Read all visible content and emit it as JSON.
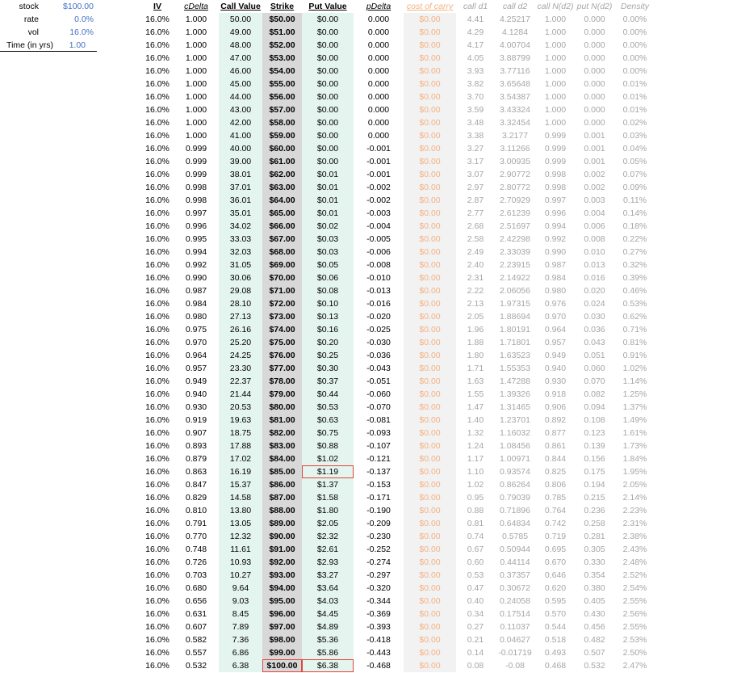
{
  "params": [
    {
      "label": "stock",
      "value": "$100.00"
    },
    {
      "label": "rate",
      "value": "0.0%"
    },
    {
      "label": "vol",
      "value": "16.0%"
    },
    {
      "label": "Time (in yrs)",
      "value": "1.00"
    }
  ],
  "headers": {
    "iv": "IV",
    "cdelta": "cDelta",
    "callvalue": "Call Value",
    "strike": "Strike",
    "putvalue": "Put Value",
    "pdelta": "pDelta",
    "carry": "cost of carry",
    "d1": "call d1",
    "d2": "call d2",
    "nd2": "call N(d2)",
    "pnd2": "put N(d2)",
    "density": "Density"
  },
  "colors": {
    "param_value": "#4472c4",
    "call_put_bg": "#e4f4ee",
    "strike_bg": "#d8d8d8",
    "carry_text": "#f4b183",
    "carry_bg": "#f2f2f2",
    "dim_text": "#a6a6a6",
    "highlight_border": "#e0463e"
  },
  "rows": [
    {
      "iv": "16.0%",
      "cd": "1.000",
      "cv": "50.00",
      "st": "$50.00",
      "pv": "$0.00",
      "pd": "0.000",
      "cc": "$0.00",
      "d1": "4.41",
      "d2": "4.25217",
      "n1": "1.000",
      "n2": "0.000",
      "dn": "0.00%"
    },
    {
      "iv": "16.0%",
      "cd": "1.000",
      "cv": "49.00",
      "st": "$51.00",
      "pv": "$0.00",
      "pd": "0.000",
      "cc": "$0.00",
      "d1": "4.29",
      "d2": "4.1284",
      "n1": "1.000",
      "n2": "0.000",
      "dn": "0.00%"
    },
    {
      "iv": "16.0%",
      "cd": "1.000",
      "cv": "48.00",
      "st": "$52.00",
      "pv": "$0.00",
      "pd": "0.000",
      "cc": "$0.00",
      "d1": "4.17",
      "d2": "4.00704",
      "n1": "1.000",
      "n2": "0.000",
      "dn": "0.00%"
    },
    {
      "iv": "16.0%",
      "cd": "1.000",
      "cv": "47.00",
      "st": "$53.00",
      "pv": "$0.00",
      "pd": "0.000",
      "cc": "$0.00",
      "d1": "4.05",
      "d2": "3.88799",
      "n1": "1.000",
      "n2": "0.000",
      "dn": "0.00%"
    },
    {
      "iv": "16.0%",
      "cd": "1.000",
      "cv": "46.00",
      "st": "$54.00",
      "pv": "$0.00",
      "pd": "0.000",
      "cc": "$0.00",
      "d1": "3.93",
      "d2": "3.77116",
      "n1": "1.000",
      "n2": "0.000",
      "dn": "0.00%"
    },
    {
      "iv": "16.0%",
      "cd": "1.000",
      "cv": "45.00",
      "st": "$55.00",
      "pv": "$0.00",
      "pd": "0.000",
      "cc": "$0.00",
      "d1": "3.82",
      "d2": "3.65648",
      "n1": "1.000",
      "n2": "0.000",
      "dn": "0.01%"
    },
    {
      "iv": "16.0%",
      "cd": "1.000",
      "cv": "44.00",
      "st": "$56.00",
      "pv": "$0.00",
      "pd": "0.000",
      "cc": "$0.00",
      "d1": "3.70",
      "d2": "3.54387",
      "n1": "1.000",
      "n2": "0.000",
      "dn": "0.01%"
    },
    {
      "iv": "16.0%",
      "cd": "1.000",
      "cv": "43.00",
      "st": "$57.00",
      "pv": "$0.00",
      "pd": "0.000",
      "cc": "$0.00",
      "d1": "3.59",
      "d2": "3.43324",
      "n1": "1.000",
      "n2": "0.000",
      "dn": "0.01%"
    },
    {
      "iv": "16.0%",
      "cd": "1.000",
      "cv": "42.00",
      "st": "$58.00",
      "pv": "$0.00",
      "pd": "0.000",
      "cc": "$0.00",
      "d1": "3.48",
      "d2": "3.32454",
      "n1": "1.000",
      "n2": "0.000",
      "dn": "0.02%"
    },
    {
      "iv": "16.0%",
      "cd": "1.000",
      "cv": "41.00",
      "st": "$59.00",
      "pv": "$0.00",
      "pd": "0.000",
      "cc": "$0.00",
      "d1": "3.38",
      "d2": "3.2177",
      "n1": "0.999",
      "n2": "0.001",
      "dn": "0.03%"
    },
    {
      "iv": "16.0%",
      "cd": "0.999",
      "cv": "40.00",
      "st": "$60.00",
      "pv": "$0.00",
      "pd": "-0.001",
      "cc": "$0.00",
      "d1": "3.27",
      "d2": "3.11266",
      "n1": "0.999",
      "n2": "0.001",
      "dn": "0.04%"
    },
    {
      "iv": "16.0%",
      "cd": "0.999",
      "cv": "39.00",
      "st": "$61.00",
      "pv": "$0.00",
      "pd": "-0.001",
      "cc": "$0.00",
      "d1": "3.17",
      "d2": "3.00935",
      "n1": "0.999",
      "n2": "0.001",
      "dn": "0.05%"
    },
    {
      "iv": "16.0%",
      "cd": "0.999",
      "cv": "38.01",
      "st": "$62.00",
      "pv": "$0.01",
      "pd": "-0.001",
      "cc": "$0.00",
      "d1": "3.07",
      "d2": "2.90772",
      "n1": "0.998",
      "n2": "0.002",
      "dn": "0.07%"
    },
    {
      "iv": "16.0%",
      "cd": "0.998",
      "cv": "37.01",
      "st": "$63.00",
      "pv": "$0.01",
      "pd": "-0.002",
      "cc": "$0.00",
      "d1": "2.97",
      "d2": "2.80772",
      "n1": "0.998",
      "n2": "0.002",
      "dn": "0.09%"
    },
    {
      "iv": "16.0%",
      "cd": "0.998",
      "cv": "36.01",
      "st": "$64.00",
      "pv": "$0.01",
      "pd": "-0.002",
      "cc": "$0.00",
      "d1": "2.87",
      "d2": "2.70929",
      "n1": "0.997",
      "n2": "0.003",
      "dn": "0.11%"
    },
    {
      "iv": "16.0%",
      "cd": "0.997",
      "cv": "35.01",
      "st": "$65.00",
      "pv": "$0.01",
      "pd": "-0.003",
      "cc": "$0.00",
      "d1": "2.77",
      "d2": "2.61239",
      "n1": "0.996",
      "n2": "0.004",
      "dn": "0.14%"
    },
    {
      "iv": "16.0%",
      "cd": "0.996",
      "cv": "34.02",
      "st": "$66.00",
      "pv": "$0.02",
      "pd": "-0.004",
      "cc": "$0.00",
      "d1": "2.68",
      "d2": "2.51697",
      "n1": "0.994",
      "n2": "0.006",
      "dn": "0.18%"
    },
    {
      "iv": "16.0%",
      "cd": "0.995",
      "cv": "33.03",
      "st": "$67.00",
      "pv": "$0.03",
      "pd": "-0.005",
      "cc": "$0.00",
      "d1": "2.58",
      "d2": "2.42298",
      "n1": "0.992",
      "n2": "0.008",
      "dn": "0.22%"
    },
    {
      "iv": "16.0%",
      "cd": "0.994",
      "cv": "32.03",
      "st": "$68.00",
      "pv": "$0.03",
      "pd": "-0.006",
      "cc": "$0.00",
      "d1": "2.49",
      "d2": "2.33039",
      "n1": "0.990",
      "n2": "0.010",
      "dn": "0.27%"
    },
    {
      "iv": "16.0%",
      "cd": "0.992",
      "cv": "31.05",
      "st": "$69.00",
      "pv": "$0.05",
      "pd": "-0.008",
      "cc": "$0.00",
      "d1": "2.40",
      "d2": "2.23915",
      "n1": "0.987",
      "n2": "0.013",
      "dn": "0.32%"
    },
    {
      "iv": "16.0%",
      "cd": "0.990",
      "cv": "30.06",
      "st": "$70.00",
      "pv": "$0.06",
      "pd": "-0.010",
      "cc": "$0.00",
      "d1": "2.31",
      "d2": "2.14922",
      "n1": "0.984",
      "n2": "0.016",
      "dn": "0.39%"
    },
    {
      "iv": "16.0%",
      "cd": "0.987",
      "cv": "29.08",
      "st": "$71.00",
      "pv": "$0.08",
      "pd": "-0.013",
      "cc": "$0.00",
      "d1": "2.22",
      "d2": "2.06056",
      "n1": "0.980",
      "n2": "0.020",
      "dn": "0.46%"
    },
    {
      "iv": "16.0%",
      "cd": "0.984",
      "cv": "28.10",
      "st": "$72.00",
      "pv": "$0.10",
      "pd": "-0.016",
      "cc": "$0.00",
      "d1": "2.13",
      "d2": "1.97315",
      "n1": "0.976",
      "n2": "0.024",
      "dn": "0.53%"
    },
    {
      "iv": "16.0%",
      "cd": "0.980",
      "cv": "27.13",
      "st": "$73.00",
      "pv": "$0.13",
      "pd": "-0.020",
      "cc": "$0.00",
      "d1": "2.05",
      "d2": "1.88694",
      "n1": "0.970",
      "n2": "0.030",
      "dn": "0.62%"
    },
    {
      "iv": "16.0%",
      "cd": "0.975",
      "cv": "26.16",
      "st": "$74.00",
      "pv": "$0.16",
      "pd": "-0.025",
      "cc": "$0.00",
      "d1": "1.96",
      "d2": "1.80191",
      "n1": "0.964",
      "n2": "0.036",
      "dn": "0.71%"
    },
    {
      "iv": "16.0%",
      "cd": "0.970",
      "cv": "25.20",
      "st": "$75.00",
      "pv": "$0.20",
      "pd": "-0.030",
      "cc": "$0.00",
      "d1": "1.88",
      "d2": "1.71801",
      "n1": "0.957",
      "n2": "0.043",
      "dn": "0.81%"
    },
    {
      "iv": "16.0%",
      "cd": "0.964",
      "cv": "24.25",
      "st": "$76.00",
      "pv": "$0.25",
      "pd": "-0.036",
      "cc": "$0.00",
      "d1": "1.80",
      "d2": "1.63523",
      "n1": "0.949",
      "n2": "0.051",
      "dn": "0.91%"
    },
    {
      "iv": "16.0%",
      "cd": "0.957",
      "cv": "23.30",
      "st": "$77.00",
      "pv": "$0.30",
      "pd": "-0.043",
      "cc": "$0.00",
      "d1": "1.71",
      "d2": "1.55353",
      "n1": "0.940",
      "n2": "0.060",
      "dn": "1.02%"
    },
    {
      "iv": "16.0%",
      "cd": "0.949",
      "cv": "22.37",
      "st": "$78.00",
      "pv": "$0.37",
      "pd": "-0.051",
      "cc": "$0.00",
      "d1": "1.63",
      "d2": "1.47288",
      "n1": "0.930",
      "n2": "0.070",
      "dn": "1.14%"
    },
    {
      "iv": "16.0%",
      "cd": "0.940",
      "cv": "21.44",
      "st": "$79.00",
      "pv": "$0.44",
      "pd": "-0.060",
      "cc": "$0.00",
      "d1": "1.55",
      "d2": "1.39326",
      "n1": "0.918",
      "n2": "0.082",
      "dn": "1.25%"
    },
    {
      "iv": "16.0%",
      "cd": "0.930",
      "cv": "20.53",
      "st": "$80.00",
      "pv": "$0.53",
      "pd": "-0.070",
      "cc": "$0.00",
      "d1": "1.47",
      "d2": "1.31465",
      "n1": "0.906",
      "n2": "0.094",
      "dn": "1.37%"
    },
    {
      "iv": "16.0%",
      "cd": "0.919",
      "cv": "19.63",
      "st": "$81.00",
      "pv": "$0.63",
      "pd": "-0.081",
      "cc": "$0.00",
      "d1": "1.40",
      "d2": "1.23701",
      "n1": "0.892",
      "n2": "0.108",
      "dn": "1.49%"
    },
    {
      "iv": "16.0%",
      "cd": "0.907",
      "cv": "18.75",
      "st": "$82.00",
      "pv": "$0.75",
      "pd": "-0.093",
      "cc": "$0.00",
      "d1": "1.32",
      "d2": "1.16032",
      "n1": "0.877",
      "n2": "0.123",
      "dn": "1.61%"
    },
    {
      "iv": "16.0%",
      "cd": "0.893",
      "cv": "17.88",
      "st": "$83.00",
      "pv": "$0.88",
      "pd": "-0.107",
      "cc": "$0.00",
      "d1": "1.24",
      "d2": "1.08456",
      "n1": "0.861",
      "n2": "0.139",
      "dn": "1.73%"
    },
    {
      "iv": "16.0%",
      "cd": "0.879",
      "cv": "17.02",
      "st": "$84.00",
      "pv": "$1.02",
      "pd": "-0.121",
      "cc": "$0.00",
      "d1": "1.17",
      "d2": "1.00971",
      "n1": "0.844",
      "n2": "0.156",
      "dn": "1.84%"
    },
    {
      "iv": "16.0%",
      "cd": "0.863",
      "cv": "16.19",
      "st": "$85.00",
      "pv": "$1.19",
      "pd": "-0.137",
      "cc": "$0.00",
      "d1": "1.10",
      "d2": "0.93574",
      "n1": "0.825",
      "n2": "0.175",
      "dn": "1.95%",
      "hl_pv": true
    },
    {
      "iv": "16.0%",
      "cd": "0.847",
      "cv": "15.37",
      "st": "$86.00",
      "pv": "$1.37",
      "pd": "-0.153",
      "cc": "$0.00",
      "d1": "1.02",
      "d2": "0.86264",
      "n1": "0.806",
      "n2": "0.194",
      "dn": "2.05%"
    },
    {
      "iv": "16.0%",
      "cd": "0.829",
      "cv": "14.58",
      "st": "$87.00",
      "pv": "$1.58",
      "pd": "-0.171",
      "cc": "$0.00",
      "d1": "0.95",
      "d2": "0.79039",
      "n1": "0.785",
      "n2": "0.215",
      "dn": "2.14%"
    },
    {
      "iv": "16.0%",
      "cd": "0.810",
      "cv": "13.80",
      "st": "$88.00",
      "pv": "$1.80",
      "pd": "-0.190",
      "cc": "$0.00",
      "d1": "0.88",
      "d2": "0.71896",
      "n1": "0.764",
      "n2": "0.236",
      "dn": "2.23%"
    },
    {
      "iv": "16.0%",
      "cd": "0.791",
      "cv": "13.05",
      "st": "$89.00",
      "pv": "$2.05",
      "pd": "-0.209",
      "cc": "$0.00",
      "d1": "0.81",
      "d2": "0.64834",
      "n1": "0.742",
      "n2": "0.258",
      "dn": "2.31%"
    },
    {
      "iv": "16.0%",
      "cd": "0.770",
      "cv": "12.32",
      "st": "$90.00",
      "pv": "$2.32",
      "pd": "-0.230",
      "cc": "$0.00",
      "d1": "0.74",
      "d2": "0.5785",
      "n1": "0.719",
      "n2": "0.281",
      "dn": "2.38%"
    },
    {
      "iv": "16.0%",
      "cd": "0.748",
      "cv": "11.61",
      "st": "$91.00",
      "pv": "$2.61",
      "pd": "-0.252",
      "cc": "$0.00",
      "d1": "0.67",
      "d2": "0.50944",
      "n1": "0.695",
      "n2": "0.305",
      "dn": "2.43%"
    },
    {
      "iv": "16.0%",
      "cd": "0.726",
      "cv": "10.93",
      "st": "$92.00",
      "pv": "$2.93",
      "pd": "-0.274",
      "cc": "$0.00",
      "d1": "0.60",
      "d2": "0.44114",
      "n1": "0.670",
      "n2": "0.330",
      "dn": "2.48%"
    },
    {
      "iv": "16.0%",
      "cd": "0.703",
      "cv": "10.27",
      "st": "$93.00",
      "pv": "$3.27",
      "pd": "-0.297",
      "cc": "$0.00",
      "d1": "0.53",
      "d2": "0.37357",
      "n1": "0.646",
      "n2": "0.354",
      "dn": "2.52%"
    },
    {
      "iv": "16.0%",
      "cd": "0.680",
      "cv": "9.64",
      "st": "$94.00",
      "pv": "$3.64",
      "pd": "-0.320",
      "cc": "$0.00",
      "d1": "0.47",
      "d2": "0.30672",
      "n1": "0.620",
      "n2": "0.380",
      "dn": "2.54%"
    },
    {
      "iv": "16.0%",
      "cd": "0.656",
      "cv": "9.03",
      "st": "$95.00",
      "pv": "$4.03",
      "pd": "-0.344",
      "cc": "$0.00",
      "d1": "0.40",
      "d2": "0.24058",
      "n1": "0.595",
      "n2": "0.405",
      "dn": "2.55%"
    },
    {
      "iv": "16.0%",
      "cd": "0.631",
      "cv": "8.45",
      "st": "$96.00",
      "pv": "$4.45",
      "pd": "-0.369",
      "cc": "$0.00",
      "d1": "0.34",
      "d2": "0.17514",
      "n1": "0.570",
      "n2": "0.430",
      "dn": "2.56%"
    },
    {
      "iv": "16.0%",
      "cd": "0.607",
      "cv": "7.89",
      "st": "$97.00",
      "pv": "$4.89",
      "pd": "-0.393",
      "cc": "$0.00",
      "d1": "0.27",
      "d2": "0.11037",
      "n1": "0.544",
      "n2": "0.456",
      "dn": "2.55%"
    },
    {
      "iv": "16.0%",
      "cd": "0.582",
      "cv": "7.36",
      "st": "$98.00",
      "pv": "$5.36",
      "pd": "-0.418",
      "cc": "$0.00",
      "d1": "0.21",
      "d2": "0.04627",
      "n1": "0.518",
      "n2": "0.482",
      "dn": "2.53%"
    },
    {
      "iv": "16.0%",
      "cd": "0.557",
      "cv": "6.86",
      "st": "$99.00",
      "pv": "$5.86",
      "pd": "-0.443",
      "cc": "$0.00",
      "d1": "0.14",
      "d2": "-0.01719",
      "n1": "0.493",
      "n2": "0.507",
      "dn": "2.50%"
    },
    {
      "iv": "16.0%",
      "cd": "0.532",
      "cv": "6.38",
      "st": "$100.00",
      "pv": "$6.38",
      "pd": "-0.468",
      "cc": "$0.00",
      "d1": "0.08",
      "d2": "-0.08",
      "n1": "0.468",
      "n2": "0.532",
      "dn": "2.47%",
      "hl_pv": true
    }
  ]
}
